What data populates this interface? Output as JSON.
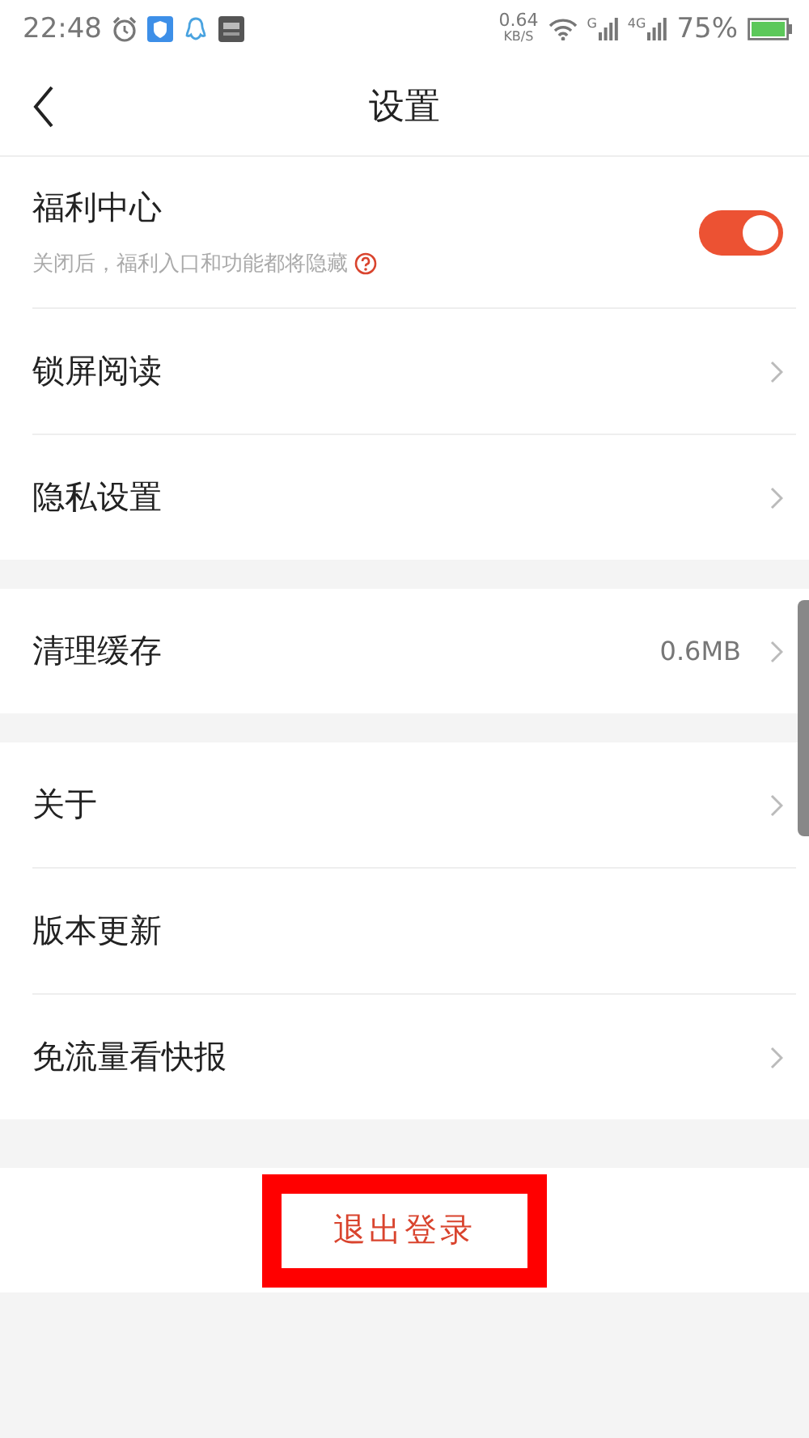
{
  "status_bar": {
    "time": "22:48",
    "speed": "0.64",
    "speed_unit": "KB/S",
    "sim1": "G",
    "sim2": "4G",
    "battery": "75%"
  },
  "header": {
    "title": "设置"
  },
  "groups": [
    {
      "items": [
        {
          "kind": "toggle",
          "label": "福利中心",
          "hint": "关闭后，福利入口和功能都将隐藏",
          "on": true
        },
        {
          "kind": "link",
          "label": "锁屏阅读"
        },
        {
          "kind": "link",
          "label": "隐私设置"
        }
      ]
    },
    {
      "items": [
        {
          "kind": "link",
          "label": "清理缓存",
          "value": "0.6MB"
        }
      ]
    },
    {
      "items": [
        {
          "kind": "link",
          "label": "关于"
        },
        {
          "kind": "plain",
          "label": "版本更新"
        },
        {
          "kind": "link",
          "label": "免流量看快报"
        }
      ]
    }
  ],
  "logout": {
    "label": "退出登录",
    "highlighted": true
  }
}
